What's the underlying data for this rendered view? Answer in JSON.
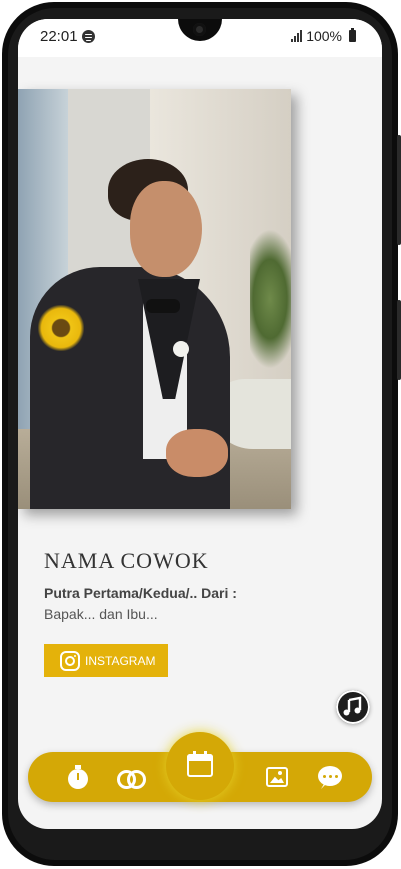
{
  "status_bar": {
    "time": "22:01",
    "battery": "100%"
  },
  "profile": {
    "name": "NAMA COWOK",
    "parent_title": "Putra Pertama/Kedua/.. Dari :",
    "parent_names": "Bapak... dan Ibu...",
    "instagram_label": "INSTAGRAM"
  },
  "icons": {
    "spotify": "spotify-icon",
    "signal": "signal-icon",
    "battery": "battery-icon",
    "instagram": "instagram-icon",
    "music": "music-note-icon",
    "nav": [
      "stopwatch-icon",
      "rings-icon",
      "calendar-icon",
      "gallery-icon",
      "chat-icon"
    ]
  },
  "colors": {
    "accent": "#d4a806",
    "button": "#e4b20a"
  }
}
